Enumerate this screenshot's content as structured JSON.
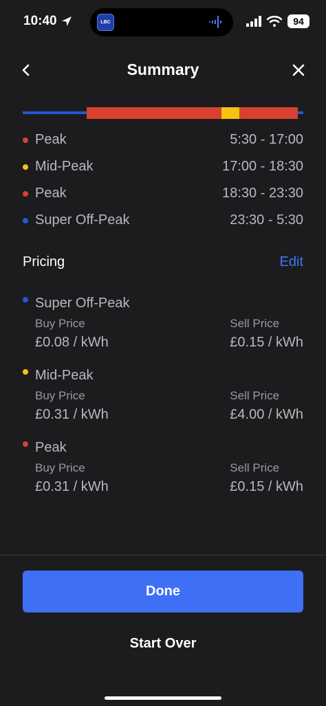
{
  "status_bar": {
    "time": "10:40",
    "battery": "94",
    "island_app_label": "LBC"
  },
  "header": {
    "title": "Summary"
  },
  "colors": {
    "peak": "#d9402f",
    "mid_peak": "#f5c412",
    "super_off_peak": "#2458d6",
    "accent": "#3e6ff5",
    "link": "#3b78f5"
  },
  "schedule": [
    {
      "name": "Peak",
      "time": "5:30 - 17:00",
      "color": "#d9402f"
    },
    {
      "name": "Mid-Peak",
      "time": "17:00 - 18:30",
      "color": "#f5c412"
    },
    {
      "name": "Peak",
      "time": "18:30 - 23:30",
      "color": "#d9402f"
    },
    {
      "name": "Super Off-Peak",
      "time": "23:30 - 5:30",
      "color": "#2458d6"
    }
  ],
  "pricing": {
    "title": "Pricing",
    "edit_label": "Edit",
    "groups": [
      {
        "name": "Super Off-Peak",
        "color": "#2458d6",
        "buy_label": "Buy Price",
        "buy_value": "£0.08 / kWh",
        "sell_label": "Sell Price",
        "sell_value": "£0.15 / kWh"
      },
      {
        "name": "Mid-Peak",
        "color": "#f5c412",
        "buy_label": "Buy Price",
        "buy_value": "£0.31 / kWh",
        "sell_label": "Sell Price",
        "sell_value": "£4.00 / kWh"
      },
      {
        "name": "Peak",
        "color": "#d9402f",
        "buy_label": "Buy Price",
        "buy_value": "£0.31 / kWh",
        "sell_label": "Sell Price",
        "sell_value": "£0.15 / kWh"
      }
    ]
  },
  "footer": {
    "done_label": "Done",
    "start_over_label": "Start Over"
  }
}
